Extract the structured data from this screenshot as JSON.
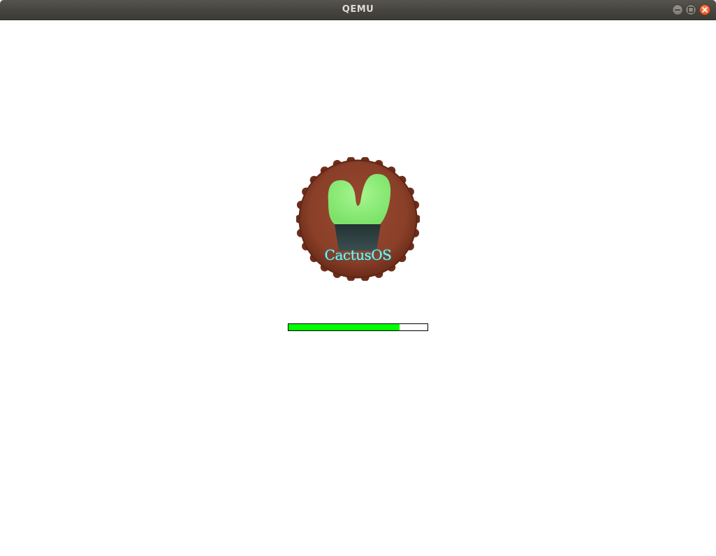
{
  "window": {
    "title": "QEMU"
  },
  "icons": {
    "minimize": "minimize-icon",
    "maximize": "maximize-icon",
    "close": "close-icon"
  },
  "boot": {
    "logo_text": "CactusOS",
    "progress": 0.8,
    "progress_color": "#00ff00"
  },
  "colors": {
    "logo_badge": "#8a3f28",
    "logo_cactus": "#8ff07a",
    "logo_pot": "#2c3d3e",
    "logo_text": "#7cf7f4",
    "close_button": "#e45c2a"
  }
}
